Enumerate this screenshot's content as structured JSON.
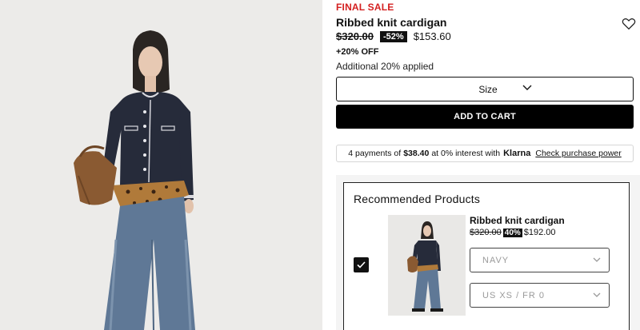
{
  "product": {
    "final_sale": "FINAL SALE",
    "title": "Ribbed knit cardigan",
    "price_original": "$320.00",
    "discount_badge": "-52%",
    "price_sale": "$153.60",
    "promo": "+20% OFF",
    "promo_note": "Additional 20% applied",
    "wishlist_icon": "heart-icon"
  },
  "actions": {
    "size_label": "Size",
    "add_to_cart": "ADD TO CART"
  },
  "klarna": {
    "prefix": "4 payments of",
    "amount": "$38.40",
    "middle": "at 0% interest with",
    "brand": "Klarna",
    "link": "Check purchase power"
  },
  "recommended": {
    "heading": "Recommended Products",
    "item": {
      "name": "Ribbed knit cardigan",
      "price_original": "$320.00",
      "discount_badge": "40%",
      "price_sale": "$192.00",
      "color_select": "NAVY",
      "size_select": "US XS / FR 0",
      "checked": true
    }
  },
  "colors": {
    "sale_red": "#d42020",
    "black": "#000000",
    "cardigan_navy": "#262b3a",
    "denim": "#5f7896"
  }
}
